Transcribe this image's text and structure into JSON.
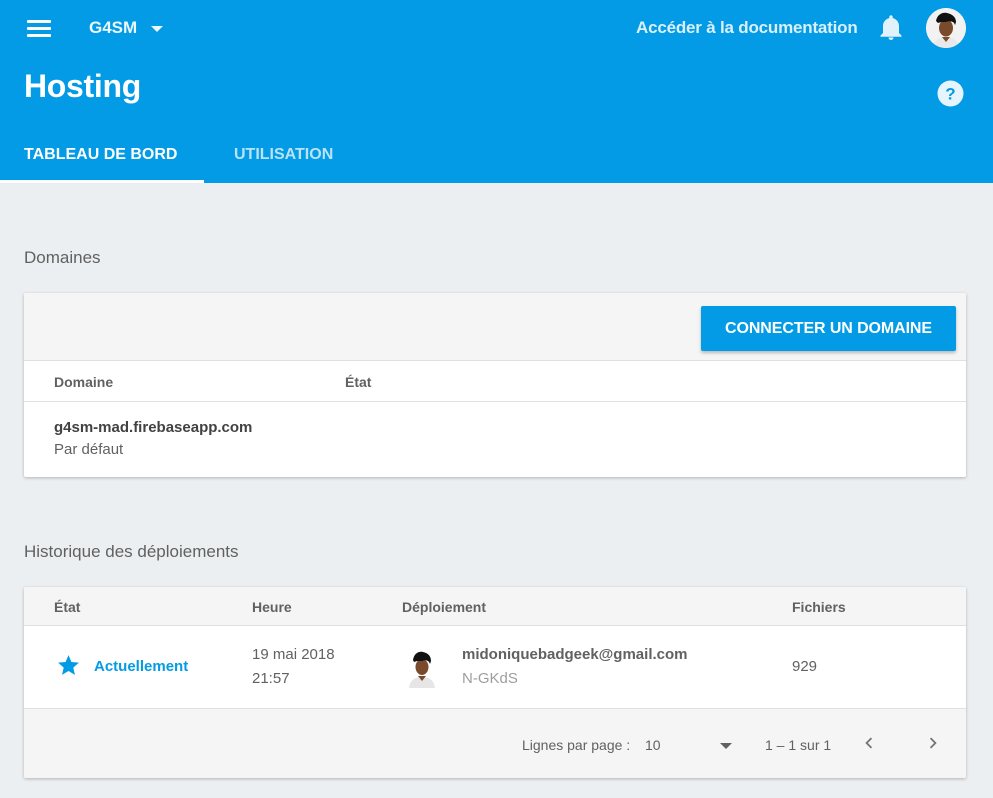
{
  "header": {
    "project_name": "G4SM",
    "docs_link": "Accéder à la documentation",
    "title": "Hosting",
    "tabs": [
      {
        "label": "TABLEAU DE BORD",
        "active": true
      },
      {
        "label": "UTILISATION",
        "active": false
      }
    ],
    "icons": {
      "menu": "menu-icon",
      "bell": "notifications-icon",
      "help": "help-icon",
      "avatar": "user-avatar"
    }
  },
  "colors": {
    "accent": "#039be5",
    "background": "#eceff1"
  },
  "domains": {
    "section_title": "Domaines",
    "connect_button": "CONNECTER UN DOMAINE",
    "columns": [
      "Domaine",
      "État"
    ],
    "rows": [
      {
        "domain": "g4sm-mad.firebaseapp.com",
        "subtitle": "Par défaut",
        "status": ""
      }
    ]
  },
  "history": {
    "section_title": "Historique des déploiements",
    "columns": [
      "État",
      "Heure",
      "Déploiement",
      "Fichiers"
    ],
    "rows": [
      {
        "status": "Actuellement",
        "status_icon": "star-icon",
        "date": "19 mai 2018",
        "time": "21:57",
        "user": "midoniquebadgeek@gmail.com",
        "deploy_id": "N-GKdS",
        "files": "929"
      }
    ],
    "pagination": {
      "rows_per_page_label": "Lignes par page :",
      "rows_per_page_value": "10",
      "range": "1 – 1 sur 1"
    }
  }
}
